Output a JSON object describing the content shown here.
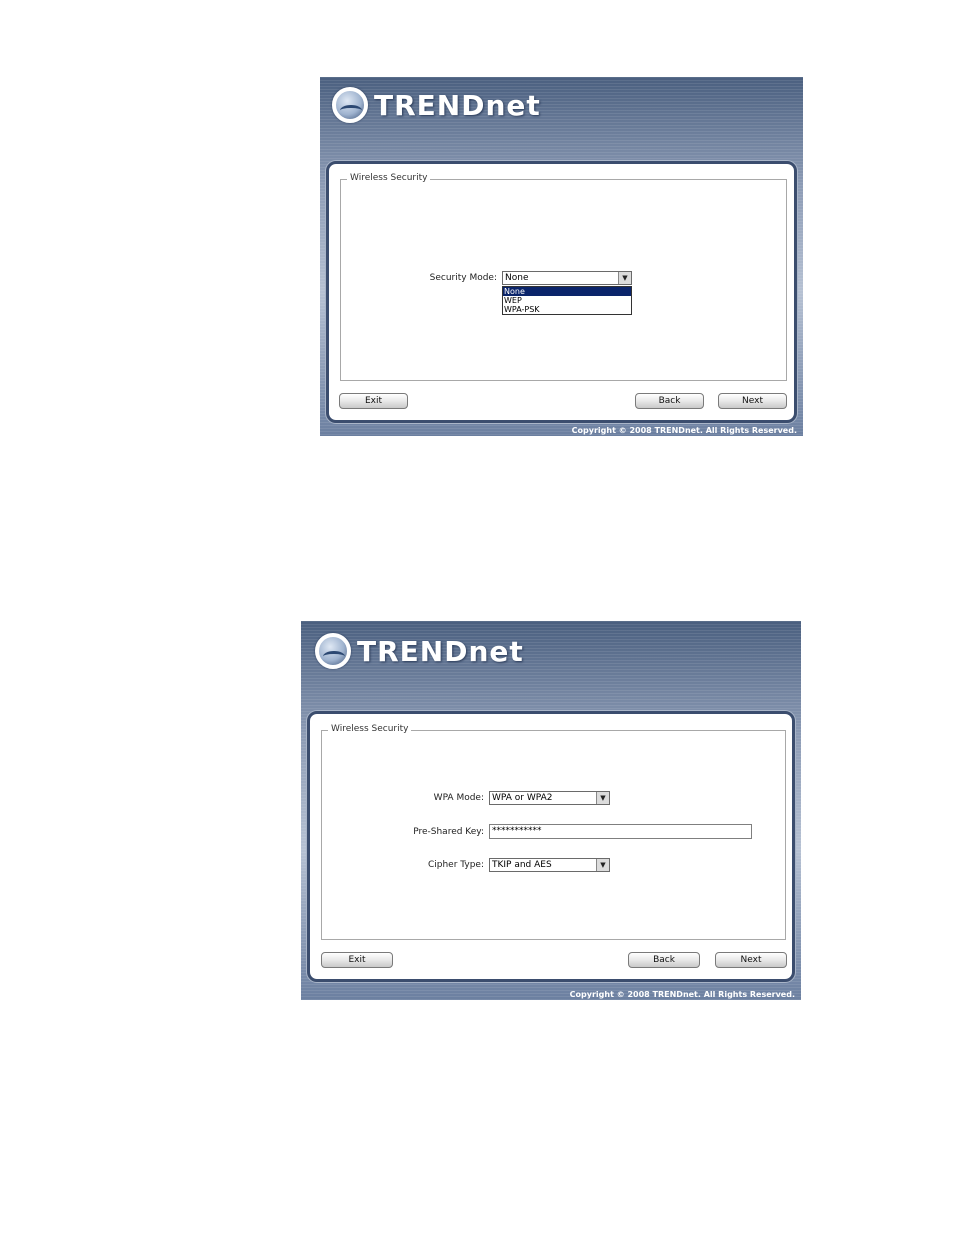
{
  "brand": {
    "logo_text": "TRENDnet"
  },
  "dialog1": {
    "section_title": "Wireless Security",
    "security_mode_label": "Security Mode:",
    "security_mode_value": "None",
    "security_mode_options": [
      "None",
      "WEP",
      "WPA-PSK"
    ],
    "exit_label": "Exit",
    "back_label": "Back",
    "next_label": "Next",
    "copyright": "Copyright © 2008 TRENDnet. All Rights Reserved."
  },
  "dialog2": {
    "section_title": "Wireless Security",
    "wpa_mode_label": "WPA Mode:",
    "wpa_mode_value": "WPA or WPA2",
    "psk_label": "Pre-Shared Key:",
    "psk_value": "***********",
    "cipher_label": "Cipher Type:",
    "cipher_value": "TKIP and AES",
    "exit_label": "Exit",
    "back_label": "Back",
    "next_label": "Next",
    "copyright": "Copyright © 2008 TRENDnet. All Rights Reserved."
  },
  "icons": {
    "dropdown_arrow": "▼"
  }
}
